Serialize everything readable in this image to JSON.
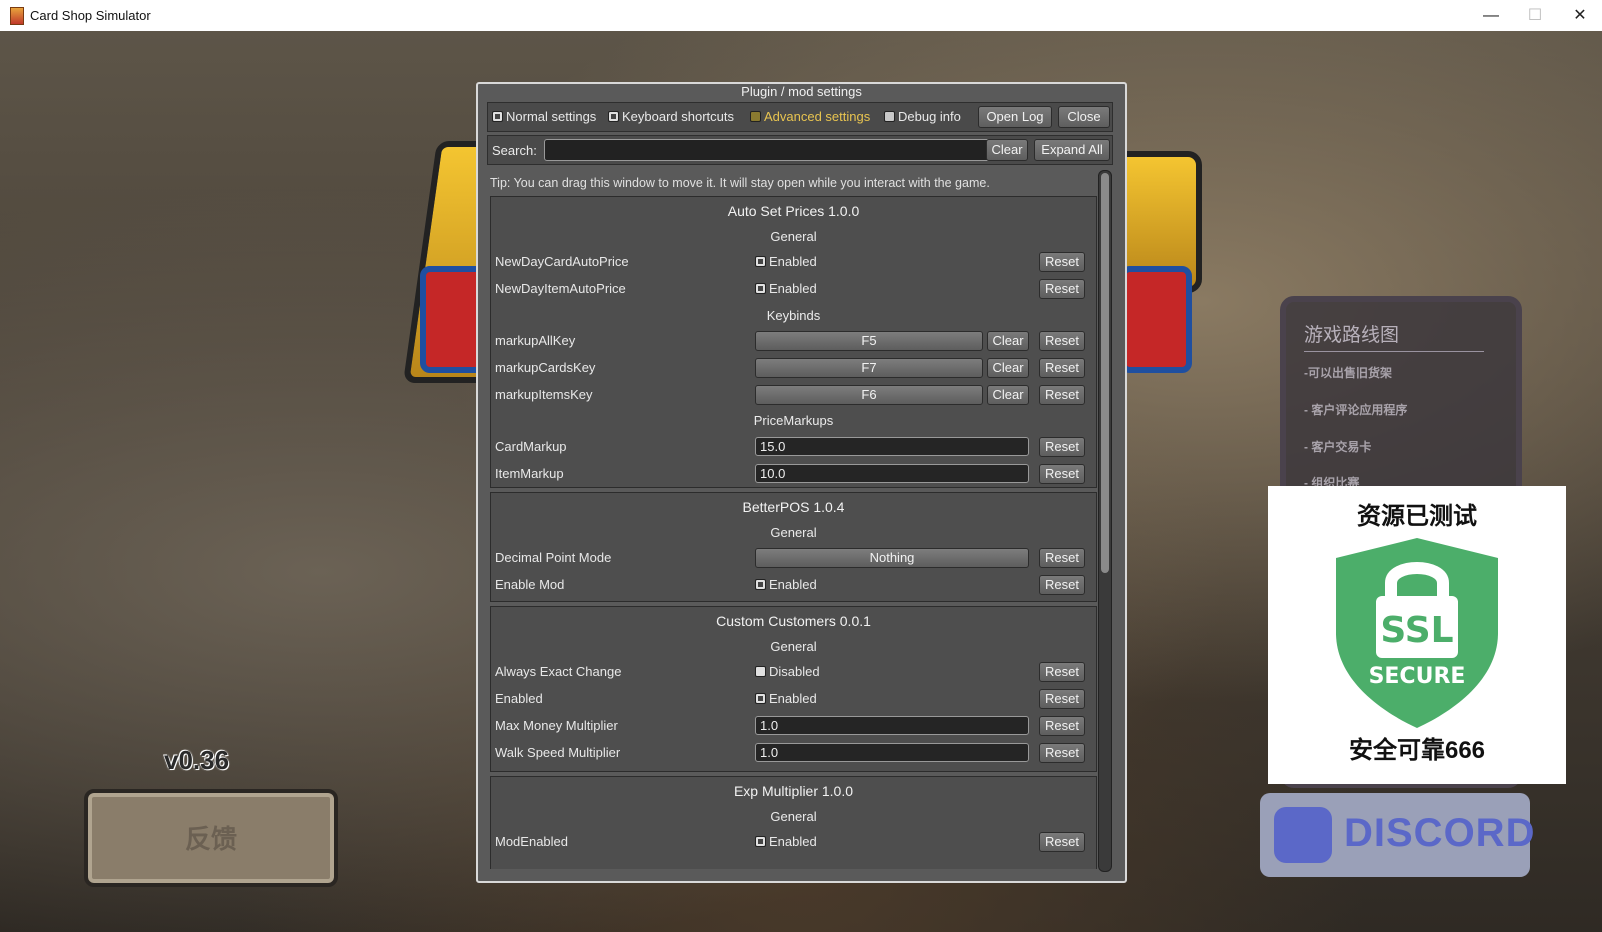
{
  "window": {
    "title": "Card Shop Simulator",
    "minimize": "—",
    "maximize": "☐",
    "close": "✕"
  },
  "background": {
    "version": "v0.36",
    "feedback_label": "反馈",
    "roadmap": {
      "title": "游戏路线图",
      "items": [
        "-可以出售旧货架",
        "- 客户评论应用程序",
        "- 客户交易卡",
        "- 组织比赛"
      ]
    },
    "ssl_badge": {
      "top_text": "资源已测试",
      "bottom_text": "安全可靠666",
      "shield_line1": "SSL",
      "shield_line2": "SECURE"
    },
    "discord_label": "DISCORD"
  },
  "panel": {
    "title": "Plugin / mod settings",
    "tabs": [
      {
        "label": "Normal settings",
        "checked": true
      },
      {
        "label": "Keyboard shortcuts",
        "checked": true
      },
      {
        "label": "Advanced settings",
        "checked": false
      },
      {
        "label": "Debug info",
        "checked": false
      }
    ],
    "open_log": "Open Log",
    "close": "Close",
    "search_label": "Search:",
    "search_value": "",
    "search_clear": "Clear",
    "expand_all": "Expand All",
    "tip": "Tip: You can drag this window to move it. It will stay open while you interact with the game.",
    "reset_label": "Reset",
    "clear_label": "Clear",
    "sections": {
      "auto_set_prices": {
        "title": "Auto Set Prices 1.0.0",
        "general": "General",
        "new_day_card": {
          "label": "NewDayCardAutoPrice",
          "value": "Enabled"
        },
        "new_day_item": {
          "label": "NewDayItemAutoPrice",
          "value": "Enabled"
        },
        "keybinds": "Keybinds",
        "markup_all": {
          "label": "markupAllKey",
          "value": "F5"
        },
        "markup_cards": {
          "label": "markupCardsKey",
          "value": "F7"
        },
        "markup_items": {
          "label": "markupItemsKey",
          "value": "F6"
        },
        "price_markups": "PriceMarkups",
        "card_markup": {
          "label": "CardMarkup",
          "value": "15.0"
        },
        "item_markup": {
          "label": "ItemMarkup",
          "value": "10.0"
        }
      },
      "better_pos": {
        "title": "BetterPOS 1.0.4",
        "general": "General",
        "decimal_point": {
          "label": "Decimal Point Mode",
          "value": "Nothing"
        },
        "enable_mod": {
          "label": "Enable Mod",
          "value": "Enabled"
        }
      },
      "custom_customers": {
        "title": "Custom Customers 0.0.1",
        "general": "General",
        "always_exact": {
          "label": "Always Exact Change",
          "value": "Disabled"
        },
        "enabled": {
          "label": "Enabled",
          "value": "Enabled"
        },
        "max_money": {
          "label": "Max Money Multiplier",
          "value": "1.0"
        },
        "walk_speed": {
          "label": "Walk Speed Multiplier",
          "value": "1.0"
        }
      },
      "exp_multiplier": {
        "title": "Exp Multiplier 1.0.0",
        "general": "General",
        "mod_enabled": {
          "label": "ModEnabled",
          "value": "Enabled"
        }
      }
    }
  }
}
